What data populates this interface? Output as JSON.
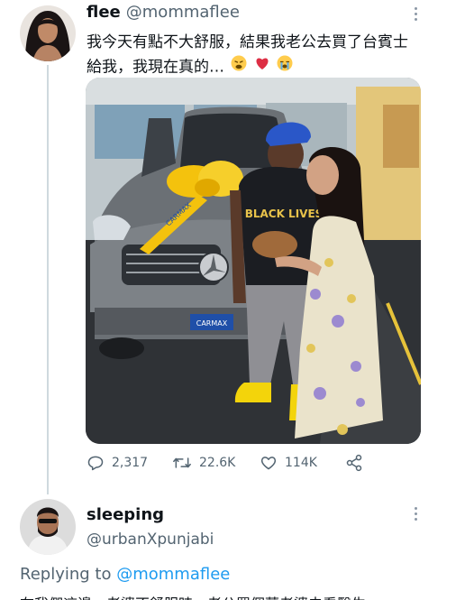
{
  "tweet": {
    "author_name": "flee",
    "author_handle": "@mommaflee",
    "text": "我今天有點不大舒服，結果我老公去買了台賓士給我，我現在真的…",
    "emojis": [
      "weary-face-emoji",
      "red-heart-emoji",
      "loudly-crying-face-emoji"
    ],
    "photo": {
      "license_plate_frame_text": "CARMAX",
      "bow_ribbon_text": "CARMAX",
      "shirt_text": "BLACK LIVES"
    },
    "stats": {
      "replies": "2,317",
      "retweets": "22.6K",
      "likes": "114K"
    },
    "icons": {
      "reply": "comment-icon",
      "retweet": "retweet-icon",
      "like": "heart-icon",
      "share": "share-icon",
      "more": "more-options-icon"
    }
  },
  "reply": {
    "author_name": "sleeping",
    "author_handle": "@urbanXpunjabi",
    "replying_prefix": "Replying to",
    "replying_to": "@mommaflee",
    "text_preview": "在我們這邊，老婆不舒服時，老公買個蒙老婆去看醫生"
  },
  "colors": {
    "accent": "#1d9bf0",
    "secondary_text": "#536471",
    "thread_line": "#cfd9de"
  }
}
